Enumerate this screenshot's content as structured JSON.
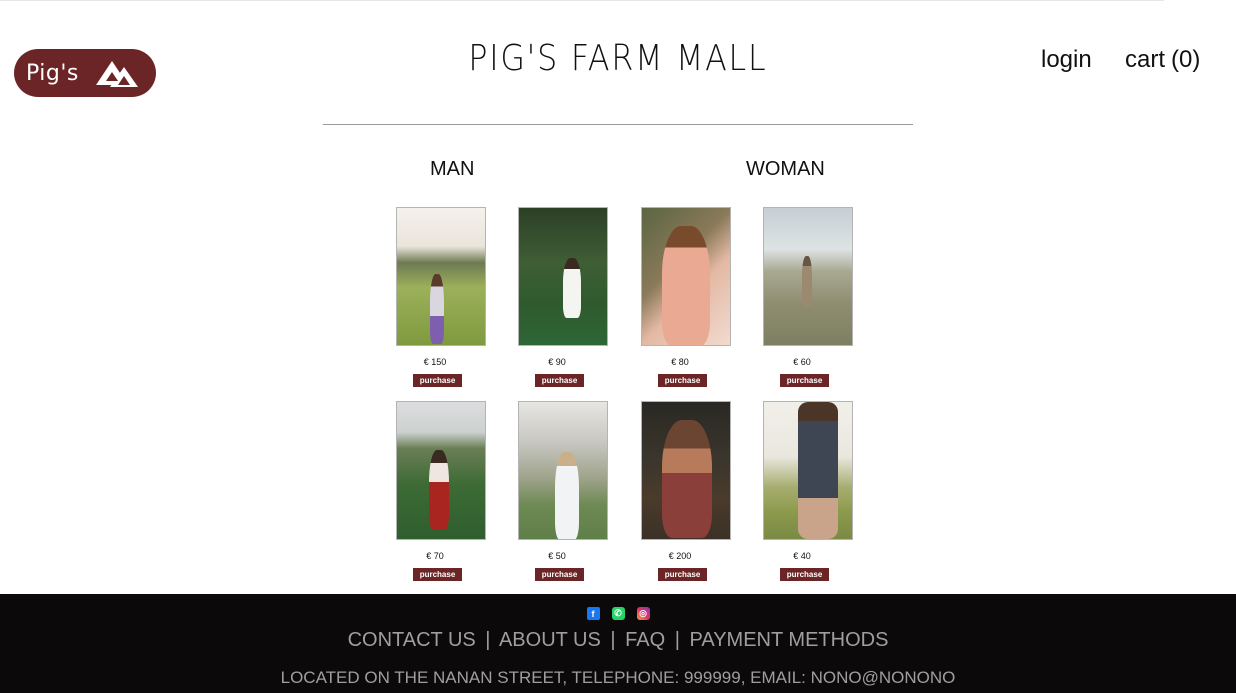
{
  "brand": {
    "logo_text": "Pig's",
    "title": "PIG'S FARM MALL",
    "color": "#6b2527"
  },
  "nav": {
    "login": "login",
    "cart_label": "cart",
    "cart_count": "(0)"
  },
  "categories": {
    "man": "MAN",
    "woman": "WOMAN"
  },
  "products": [
    {
      "price": "€ 150",
      "button": "purchase"
    },
    {
      "price": "€ 90",
      "button": "purchase"
    },
    {
      "price": "€ 80",
      "button": "purchase"
    },
    {
      "price": "€ 60",
      "button": "purchase"
    },
    {
      "price": "€ 70",
      "button": "purchase"
    },
    {
      "price": "€ 50",
      "button": "purchase"
    },
    {
      "price": "€ 200",
      "button": "purchase"
    },
    {
      "price": "€ 40",
      "button": "purchase"
    }
  ],
  "footer": {
    "social_icons": [
      "facebook-icon",
      "whatsapp-icon",
      "instagram-icon"
    ],
    "links": [
      "CONTACT US",
      "ABOUT US",
      "FAQ",
      "PAYMENT METHODS"
    ],
    "separator": "|",
    "address": "LOCATED ON THE NANAN STREET, TELEPHONE: 999999, EMAIL: NONO@NONONO"
  }
}
